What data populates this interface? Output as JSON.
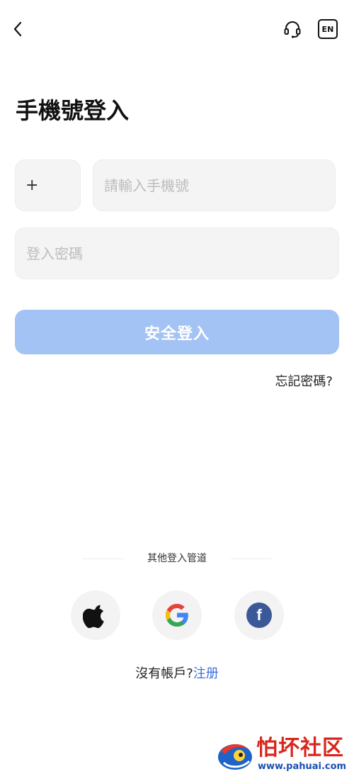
{
  "header": {
    "lang_label": "EN"
  },
  "title": "手機號登入",
  "form": {
    "country_code": "+",
    "phone_placeholder": "請輸入手機號",
    "password_placeholder": "登入密碼",
    "submit_label": "安全登入",
    "forgot_label": "忘記密碼?"
  },
  "other_login": {
    "title": "其他登入管道",
    "providers": [
      "apple",
      "google",
      "facebook"
    ]
  },
  "register": {
    "prompt": "沒有帳戶?",
    "link": "注册"
  },
  "watermark": {
    "text": "怕坏社区",
    "url": "www.pahuai.com"
  },
  "colors": {
    "primary_disabled": "#a3c3f4",
    "link": "#3f6fd8",
    "facebook": "#3b5998"
  }
}
